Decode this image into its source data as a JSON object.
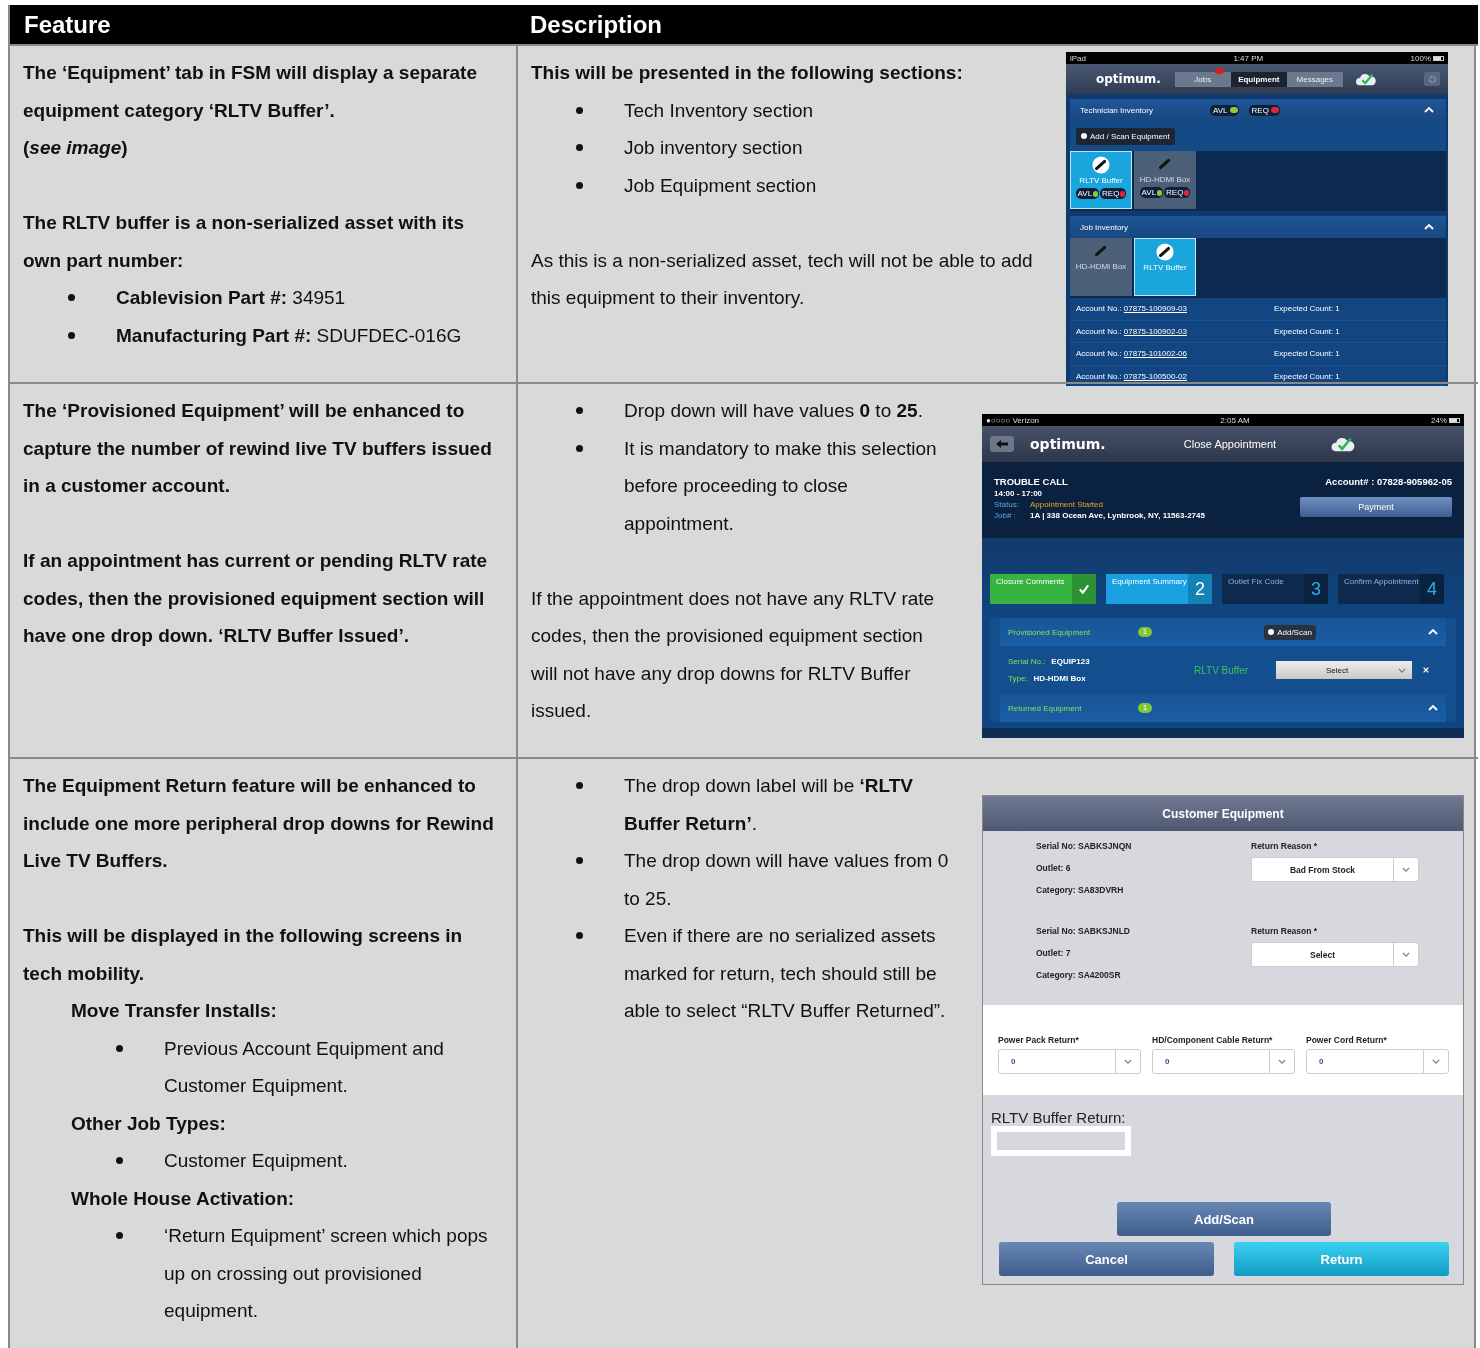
{
  "table": {
    "columns": [
      "Feature",
      "Description"
    ],
    "rows": [
      {
        "feature": [
          {
            "kind": "para",
            "bold": true,
            "text": "The ‘Equipment’ tab in FSM will display a separate equipment category ‘RLTV Buffer’."
          },
          {
            "kind": "note",
            "bold": true,
            "text": "(*see image*)"
          },
          {
            "kind": "para",
            "bold": true,
            "text": "The RLTV buffer is a non-serialized asset with its own part number:"
          },
          {
            "kind": "bullet",
            "text": "**Cablevision Part #:**  34951"
          },
          {
            "kind": "bullet",
            "text": "**Manufacturing Part #:**  SDUFDEC-016G"
          }
        ],
        "description": [
          {
            "kind": "para",
            "bold": true,
            "text": "This will be presented in the following sections:"
          },
          {
            "kind": "bullet",
            "text": "Tech Inventory section"
          },
          {
            "kind": "bullet",
            "text": "Job inventory section"
          },
          {
            "kind": "bullet",
            "text": "Job Equipment section"
          },
          {
            "kind": "para",
            "bold": false,
            "text": "As this is a non-serialized asset, tech will not be able to add this equipment to their inventory."
          }
        ],
        "screen": {
          "kind": "equipment-tab",
          "carrier": "iPad",
          "time": "1:47 PM",
          "battery": "100%",
          "logo": "optimum.",
          "tabs": [
            {
              "label": "Jobs",
              "selected": false
            },
            {
              "label": "Equipment",
              "selected": true
            },
            {
              "label": "Messages",
              "selected": false
            }
          ],
          "tech_section": {
            "title": "Technician Inventory",
            "badges": [
              {
                "label": "AVL",
                "kind": "avl"
              },
              {
                "label": "REQ",
                "kind": "req"
              }
            ],
            "button": "Add / Scan Equipment",
            "tiles": [
              {
                "label": "RLTV Buffer",
                "selected": true,
                "badges": [
                  {
                    "label": "AVL",
                    "kind": "avl"
                  },
                  {
                    "label": "REQ",
                    "kind": "req"
                  }
                ]
              },
              {
                "label": "HD-HDMI Box",
                "selected": false,
                "badges": [
                  {
                    "label": "AVL",
                    "kind": "avl"
                  },
                  {
                    "label": "REQ",
                    "kind": "req"
                  }
                ]
              }
            ]
          },
          "job_section": {
            "title": "Job Inventory",
            "tiles": [
              {
                "label": "HD-HDMI Box",
                "selected": false
              },
              {
                "label": "RLTV Buffer",
                "selected": true
              }
            ],
            "accounts": [
              {
                "label": "Account No.:",
                "number": "07875-100909-03",
                "count": "Expected Count: 1"
              },
              {
                "label": "Account No.:",
                "number": "07875-100902-03",
                "count": "Expected Count: 1"
              },
              {
                "label": "Account No.:",
                "number": "07875-101002-06",
                "count": "Expected Count: 1"
              },
              {
                "label": "Account No.:",
                "number": "07875-100500-02",
                "count": "Expected Count: 1"
              }
            ]
          }
        }
      },
      {
        "feature": [
          {
            "kind": "para",
            "bold": true,
            "text": "The ‘Provisioned Equipment’ will be enhanced to capture the number of rewind live TV buffers issued in a customer account."
          },
          {
            "kind": "para",
            "bold": true,
            "text": "If an appointment has current or pending RLTV rate codes, then the provisioned equipment section will have one drop down.  ‘RLTV Buffer Issued’."
          }
        ],
        "description": [
          {
            "kind": "bullet",
            "text": "Drop down will have values **0** to **25**."
          },
          {
            "kind": "bullet",
            "text": "It is mandatory to make this selection before proceeding to close appointment."
          },
          {
            "kind": "para",
            "bold": false,
            "text": "If the appointment does not have any RLTV rate codes, then the provisioned equipment section will not have any drop downs for RLTV Buffer issued."
          }
        ],
        "screen": {
          "kind": "close-appointment",
          "carrier": "●○○○○ Verizon",
          "time": "2:05 AM",
          "battery": "24%",
          "logo": "optimum.",
          "title": "Close Appointment",
          "call_type": "TROUBLE CALL",
          "window": "14:00 - 17:00",
          "status_label": "Status:",
          "status": "Appointment Started",
          "job_label": "Job# :",
          "address": "1A | 338  Ocean Ave, Lynbrook, NY, 11563-2745",
          "account": "Account# : 07828-905962-05",
          "payment": "Payment",
          "steps": [
            {
              "label": "Closure Comments",
              "completed": true,
              "selected": false
            },
            {
              "label": "Equipment Summary",
              "number": "2",
              "completed": false,
              "selected": true
            },
            {
              "label": "Outlet Fix Code",
              "number": "3",
              "completed": false,
              "selected": false
            },
            {
              "label": "Confirm Appointment",
              "number": "4",
              "completed": false,
              "selected": false
            }
          ],
          "provisioned": {
            "title": "Provisioned Equipment",
            "count": "1",
            "button": "Add/Scan",
            "serial_label": "Serial No.:",
            "serial": "EQUIP123",
            "type_label": "Type:",
            "type": "HD-HDMI Box",
            "dropdown_label": "RLTV Buffer",
            "dropdown_value": "Select"
          },
          "returned": {
            "title": "Returned Equipment",
            "count": "1"
          }
        }
      },
      {
        "feature": [
          {
            "kind": "para",
            "bold": true,
            "text": "The Equipment Return feature will be enhanced to include one more peripheral drop downs for Rewind Live TV Buffers."
          },
          {
            "kind": "para",
            "bold": true,
            "text": "This will be displayed in the following screens in tech mobility."
          },
          {
            "kind": "subhead",
            "text": "Move Transfer Installs:",
            "children": [
              {
                "kind": "bullet",
                "text": "Previous Account Equipment and Customer Equipment."
              }
            ]
          },
          {
            "kind": "subhead",
            "text": "Other Job Types:",
            "children": [
              {
                "kind": "bullet",
                "text": "Customer Equipment."
              }
            ]
          },
          {
            "kind": "subhead",
            "text": "Whole House Activation:",
            "children": [
              {
                "kind": "bullet",
                "text": "‘Return Equipment’ screen which pops up on crossing out provisioned equipment."
              }
            ]
          }
        ],
        "description": [
          {
            "kind": "bullet",
            "text": "The drop down label will be **‘RLTV Buffer Return’**."
          },
          {
            "kind": "bullet",
            "text": "The drop down will have values from 0 to 25."
          },
          {
            "kind": "bullet",
            "text": "Even if there are no serialized assets marked for return, tech should still be able to select “RLTV Buffer Returned”."
          }
        ],
        "screen": {
          "kind": "customer-equipment",
          "title": "Customer Equipment",
          "items": [
            {
              "serial": "Serial No: SABKSJNQN",
              "outlet": "Outlet: 6",
              "category": "Category: SA83DVRH",
              "reason_label": "Return Reason *",
              "reason": "Bad From Stock"
            },
            {
              "serial": "Serial No: SABKSJNLD",
              "outlet": "Outlet: 7",
              "category": "Category: SA4200SR",
              "reason_label": "Return Reason *",
              "reason": "Select"
            }
          ],
          "peripherals": [
            {
              "label": "Power Pack Return*",
              "value": "0"
            },
            {
              "label": "HD/Component Cable Return*",
              "value": "0"
            },
            {
              "label": "Power Cord Return*",
              "value": "0"
            }
          ],
          "buffer_label": "RLTV Buffer Return:",
          "add": "Add/Scan",
          "cancel": "Cancel",
          "confirm": "Return"
        }
      }
    ]
  }
}
